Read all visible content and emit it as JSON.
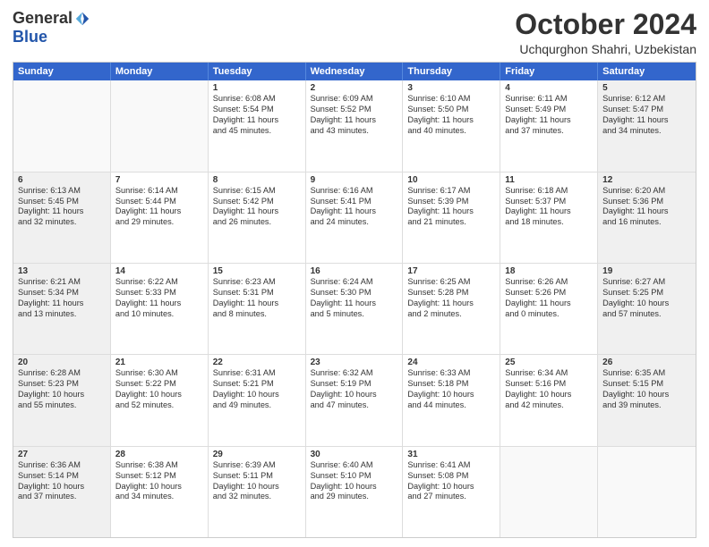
{
  "header": {
    "logo_general": "General",
    "logo_blue": "Blue",
    "month_title": "October 2024",
    "subtitle": "Uchqurghon Shahri, Uzbekistan"
  },
  "days_of_week": [
    "Sunday",
    "Monday",
    "Tuesday",
    "Wednesday",
    "Thursday",
    "Friday",
    "Saturday"
  ],
  "weeks": [
    [
      {
        "day": "",
        "lines": [],
        "empty": true
      },
      {
        "day": "",
        "lines": [],
        "empty": true
      },
      {
        "day": "1",
        "lines": [
          "Sunrise: 6:08 AM",
          "Sunset: 5:54 PM",
          "Daylight: 11 hours",
          "and 45 minutes."
        ],
        "shaded": false
      },
      {
        "day": "2",
        "lines": [
          "Sunrise: 6:09 AM",
          "Sunset: 5:52 PM",
          "Daylight: 11 hours",
          "and 43 minutes."
        ],
        "shaded": false
      },
      {
        "day": "3",
        "lines": [
          "Sunrise: 6:10 AM",
          "Sunset: 5:50 PM",
          "Daylight: 11 hours",
          "and 40 minutes."
        ],
        "shaded": false
      },
      {
        "day": "4",
        "lines": [
          "Sunrise: 6:11 AM",
          "Sunset: 5:49 PM",
          "Daylight: 11 hours",
          "and 37 minutes."
        ],
        "shaded": false
      },
      {
        "day": "5",
        "lines": [
          "Sunrise: 6:12 AM",
          "Sunset: 5:47 PM",
          "Daylight: 11 hours",
          "and 34 minutes."
        ],
        "shaded": true
      }
    ],
    [
      {
        "day": "6",
        "lines": [
          "Sunrise: 6:13 AM",
          "Sunset: 5:45 PM",
          "Daylight: 11 hours",
          "and 32 minutes."
        ],
        "shaded": true
      },
      {
        "day": "7",
        "lines": [
          "Sunrise: 6:14 AM",
          "Sunset: 5:44 PM",
          "Daylight: 11 hours",
          "and 29 minutes."
        ],
        "shaded": false
      },
      {
        "day": "8",
        "lines": [
          "Sunrise: 6:15 AM",
          "Sunset: 5:42 PM",
          "Daylight: 11 hours",
          "and 26 minutes."
        ],
        "shaded": false
      },
      {
        "day": "9",
        "lines": [
          "Sunrise: 6:16 AM",
          "Sunset: 5:41 PM",
          "Daylight: 11 hours",
          "and 24 minutes."
        ],
        "shaded": false
      },
      {
        "day": "10",
        "lines": [
          "Sunrise: 6:17 AM",
          "Sunset: 5:39 PM",
          "Daylight: 11 hours",
          "and 21 minutes."
        ],
        "shaded": false
      },
      {
        "day": "11",
        "lines": [
          "Sunrise: 6:18 AM",
          "Sunset: 5:37 PM",
          "Daylight: 11 hours",
          "and 18 minutes."
        ],
        "shaded": false
      },
      {
        "day": "12",
        "lines": [
          "Sunrise: 6:20 AM",
          "Sunset: 5:36 PM",
          "Daylight: 11 hours",
          "and 16 minutes."
        ],
        "shaded": true
      }
    ],
    [
      {
        "day": "13",
        "lines": [
          "Sunrise: 6:21 AM",
          "Sunset: 5:34 PM",
          "Daylight: 11 hours",
          "and 13 minutes."
        ],
        "shaded": true
      },
      {
        "day": "14",
        "lines": [
          "Sunrise: 6:22 AM",
          "Sunset: 5:33 PM",
          "Daylight: 11 hours",
          "and 10 minutes."
        ],
        "shaded": false
      },
      {
        "day": "15",
        "lines": [
          "Sunrise: 6:23 AM",
          "Sunset: 5:31 PM",
          "Daylight: 11 hours",
          "and 8 minutes."
        ],
        "shaded": false
      },
      {
        "day": "16",
        "lines": [
          "Sunrise: 6:24 AM",
          "Sunset: 5:30 PM",
          "Daylight: 11 hours",
          "and 5 minutes."
        ],
        "shaded": false
      },
      {
        "day": "17",
        "lines": [
          "Sunrise: 6:25 AM",
          "Sunset: 5:28 PM",
          "Daylight: 11 hours",
          "and 2 minutes."
        ],
        "shaded": false
      },
      {
        "day": "18",
        "lines": [
          "Sunrise: 6:26 AM",
          "Sunset: 5:26 PM",
          "Daylight: 11 hours",
          "and 0 minutes."
        ],
        "shaded": false
      },
      {
        "day": "19",
        "lines": [
          "Sunrise: 6:27 AM",
          "Sunset: 5:25 PM",
          "Daylight: 10 hours",
          "and 57 minutes."
        ],
        "shaded": true
      }
    ],
    [
      {
        "day": "20",
        "lines": [
          "Sunrise: 6:28 AM",
          "Sunset: 5:23 PM",
          "Daylight: 10 hours",
          "and 55 minutes."
        ],
        "shaded": true
      },
      {
        "day": "21",
        "lines": [
          "Sunrise: 6:30 AM",
          "Sunset: 5:22 PM",
          "Daylight: 10 hours",
          "and 52 minutes."
        ],
        "shaded": false
      },
      {
        "day": "22",
        "lines": [
          "Sunrise: 6:31 AM",
          "Sunset: 5:21 PM",
          "Daylight: 10 hours",
          "and 49 minutes."
        ],
        "shaded": false
      },
      {
        "day": "23",
        "lines": [
          "Sunrise: 6:32 AM",
          "Sunset: 5:19 PM",
          "Daylight: 10 hours",
          "and 47 minutes."
        ],
        "shaded": false
      },
      {
        "day": "24",
        "lines": [
          "Sunrise: 6:33 AM",
          "Sunset: 5:18 PM",
          "Daylight: 10 hours",
          "and 44 minutes."
        ],
        "shaded": false
      },
      {
        "day": "25",
        "lines": [
          "Sunrise: 6:34 AM",
          "Sunset: 5:16 PM",
          "Daylight: 10 hours",
          "and 42 minutes."
        ],
        "shaded": false
      },
      {
        "day": "26",
        "lines": [
          "Sunrise: 6:35 AM",
          "Sunset: 5:15 PM",
          "Daylight: 10 hours",
          "and 39 minutes."
        ],
        "shaded": true
      }
    ],
    [
      {
        "day": "27",
        "lines": [
          "Sunrise: 6:36 AM",
          "Sunset: 5:14 PM",
          "Daylight: 10 hours",
          "and 37 minutes."
        ],
        "shaded": true
      },
      {
        "day": "28",
        "lines": [
          "Sunrise: 6:38 AM",
          "Sunset: 5:12 PM",
          "Daylight: 10 hours",
          "and 34 minutes."
        ],
        "shaded": false
      },
      {
        "day": "29",
        "lines": [
          "Sunrise: 6:39 AM",
          "Sunset: 5:11 PM",
          "Daylight: 10 hours",
          "and 32 minutes."
        ],
        "shaded": false
      },
      {
        "day": "30",
        "lines": [
          "Sunrise: 6:40 AM",
          "Sunset: 5:10 PM",
          "Daylight: 10 hours",
          "and 29 minutes."
        ],
        "shaded": false
      },
      {
        "day": "31",
        "lines": [
          "Sunrise: 6:41 AM",
          "Sunset: 5:08 PM",
          "Daylight: 10 hours",
          "and 27 minutes."
        ],
        "shaded": false
      },
      {
        "day": "",
        "lines": [],
        "empty": true
      },
      {
        "day": "",
        "lines": [],
        "empty": true
      }
    ]
  ]
}
